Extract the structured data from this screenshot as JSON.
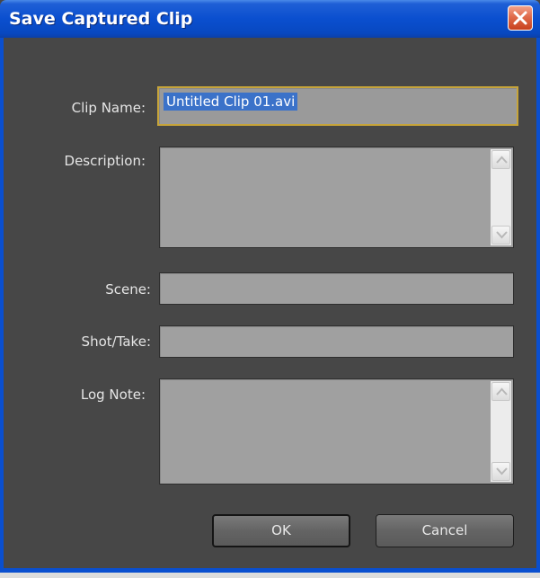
{
  "window": {
    "title": "Save Captured Clip",
    "close_icon": "close-icon",
    "colors": {
      "titlebar": "#0a4fcf",
      "body": "#474747",
      "field": "#a0a0a0",
      "focus_border": "#c6a43a",
      "selection": "#3b72c9",
      "close_button": "#e06b4b"
    }
  },
  "form": {
    "clip_name": {
      "label": "Clip Name:",
      "value": "Untitled Clip 01.avi"
    },
    "description": {
      "label": "Description:",
      "value": ""
    },
    "scene": {
      "label": "Scene:",
      "value": ""
    },
    "shot_take": {
      "label": "Shot/Take:",
      "value": ""
    },
    "log_note": {
      "label": "Log Note:",
      "value": ""
    }
  },
  "buttons": {
    "ok": "OK",
    "cancel": "Cancel"
  }
}
